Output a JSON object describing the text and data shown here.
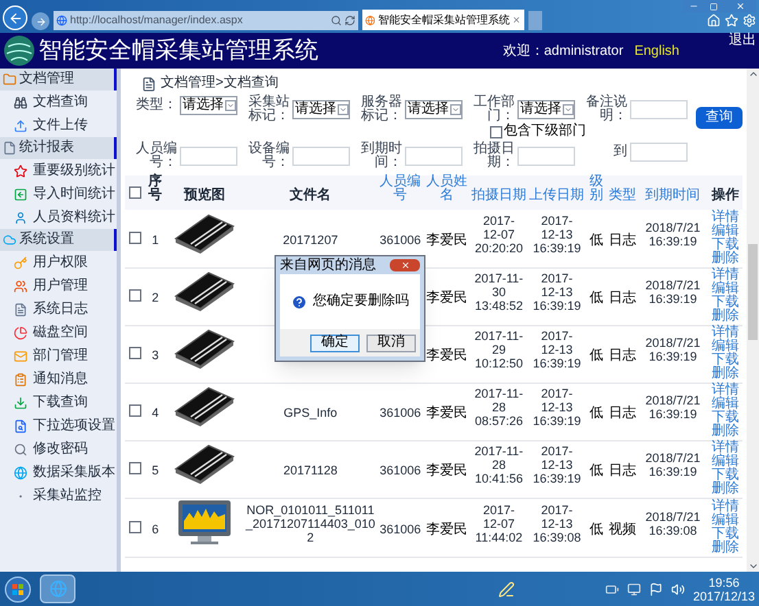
{
  "browser": {
    "address": "http://localhost/manager/index.aspx",
    "tab_title": "智能安全帽采集站管理系统"
  },
  "header": {
    "title": "智能安全帽采集站管理系统",
    "welcome": "欢迎：administrator",
    "language": "English",
    "logout": "退出"
  },
  "sidebar": [
    {
      "title": "文档管理",
      "items": [
        {
          "label": "文档查询"
        },
        {
          "label": "文件上传"
        }
      ]
    },
    {
      "title": "统计报表",
      "items": [
        {
          "label": "重要级别统计"
        },
        {
          "label": "导入时间统计"
        },
        {
          "label": "人员资料统计"
        }
      ]
    },
    {
      "title": "系统设置",
      "items": [
        {
          "label": "用户权限"
        },
        {
          "label": "用户管理"
        },
        {
          "label": "系统日志"
        },
        {
          "label": "磁盘空间"
        },
        {
          "label": "部门管理"
        },
        {
          "label": "通知消息"
        },
        {
          "label": "下载查询"
        },
        {
          "label": "下拉选项设置"
        },
        {
          "label": "修改密码"
        },
        {
          "label": "数据采集版本"
        },
        {
          "label": "采集站监控"
        }
      ]
    }
  ],
  "breadcrumb": "文档管理>文档查询",
  "filters": [
    [
      {
        "label": "类型：",
        "kind": "select",
        "value": "请选择"
      },
      {
        "label": "采集站标记：",
        "kind": "select",
        "value": "请选择"
      },
      {
        "label": "服务器标记：",
        "kind": "select",
        "value": "请选择"
      },
      {
        "label": "工作部门：",
        "kind": "select",
        "value": "请选择",
        "checkbox": {
          "label": "包含下级部门",
          "checked": false
        }
      },
      {
        "label": "备注说明：",
        "kind": "input"
      }
    ],
    [
      {
        "label": "人员编号：",
        "kind": "input"
      },
      {
        "label": "设备编号：",
        "kind": "input"
      },
      {
        "label": "到期时间：",
        "kind": "input"
      },
      {
        "label": "拍摄日期：",
        "kind": "input"
      },
      {
        "label": "到",
        "kind": "input"
      }
    ]
  ],
  "search_button": "查询",
  "table": {
    "select_all": {
      "checked": false
    },
    "columns": [
      {
        "label": "序号",
        "sortable": false
      },
      {
        "label": "预览图",
        "sortable": false
      },
      {
        "label": "文件名",
        "sortable": false
      },
      {
        "label": "人员编号",
        "sortable": true
      },
      {
        "label": "人员姓名",
        "sortable": true
      },
      {
        "label": "拍摄日期",
        "sortable": true
      },
      {
        "label": "上传日期",
        "sortable": true
      },
      {
        "label": "级别",
        "sortable": true
      },
      {
        "label": "类型",
        "sortable": true
      },
      {
        "label": "到期时间",
        "sortable": true
      },
      {
        "label": "操作",
        "sortable": false
      }
    ],
    "rows": [
      {
        "checked": false,
        "index": "1",
        "kind": "notebook",
        "file_name": "20171207",
        "person_id": "361006",
        "person_name": "李爱民",
        "shot_date": "2017-12-07 20:20:20",
        "upload_date": "2017-12-13 16:39:19",
        "level": "低",
        "type": "日志",
        "expires": "2018/7/21 16:39:19",
        "actions": [
          "详情",
          "编辑",
          "下载",
          "删除"
        ]
      },
      {
        "checked": false,
        "index": "2",
        "kind": "notebook",
        "person_name": "李爱民",
        "shot_date": "2017-11-30 13:48:52",
        "upload_date": "2017-12-13 16:39:19",
        "level": "低",
        "type": "日志",
        "expires": "2018/7/21 16:39:19",
        "actions": [
          "详情",
          "编辑",
          "下载",
          "删除"
        ]
      },
      {
        "checked": false,
        "index": "3",
        "kind": "notebook",
        "person_name": "李爱民",
        "shot_date": "2017-11-29 10:12:50",
        "upload_date": "2017-12-13 16:39:19",
        "level": "低",
        "type": "日志",
        "expires": "2018/7/21 16:39:19",
        "actions": [
          "详情",
          "编辑",
          "下载",
          "删除"
        ]
      },
      {
        "checked": false,
        "index": "4",
        "kind": "notebook",
        "file_name": "GPS_Info",
        "person_id": "361006",
        "person_name": "李爱民",
        "shot_date": "2017-11-28 08:57:26",
        "upload_date": "2017-12-13 16:39:19",
        "level": "低",
        "type": "日志",
        "expires": "2018/7/21 16:39:19",
        "actions": [
          "详情",
          "编辑",
          "下载",
          "删除"
        ]
      },
      {
        "checked": false,
        "index": "5",
        "kind": "notebook",
        "file_name": "20171128",
        "person_id": "361006",
        "person_name": "李爱民",
        "shot_date": "2017-11-28 10:41:56",
        "upload_date": "2017-12-13 16:39:19",
        "level": "低",
        "type": "日志",
        "expires": "2018/7/21 16:39:19",
        "actions": [
          "详情",
          "编辑",
          "下载",
          "删除"
        ]
      },
      {
        "checked": false,
        "index": "6",
        "kind": "monitor",
        "file_name": "NOR_0101011_511011_20171207114403_0102",
        "person_id": "361006",
        "person_name": "李爱民",
        "shot_date": "2017-12-07 11:44:02",
        "upload_date": "2017-12-13 16:39:08",
        "level": "低",
        "type": "视频",
        "expires": "2018/7/21 16:39:08",
        "actions": [
          "详情",
          "编辑",
          "下载",
          "删除"
        ]
      }
    ]
  },
  "dialog": {
    "title": "来自网页的消息",
    "message": "您确定要删除吗",
    "buttons": [
      {
        "label": "确定",
        "selected": true
      },
      {
        "label": "取消",
        "selected": false
      }
    ]
  },
  "taskbar": {
    "time": "19:56",
    "date": "2017/12/13"
  }
}
